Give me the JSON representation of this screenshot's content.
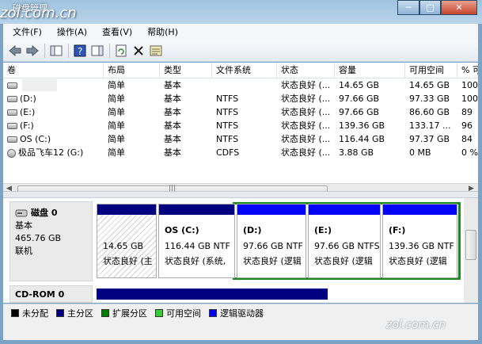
{
  "window": {
    "title": "磁盘管理",
    "watermark": "zol.com.cn",
    "min": "─",
    "max": "□",
    "close": "✕"
  },
  "menu": [
    "文件(F)",
    "操作(A)",
    "查看(V)",
    "帮助(H)"
  ],
  "toolbar": {
    "icons": [
      "back-arrow-icon",
      "forward-arrow-icon",
      "console-tree-icon",
      "help-icon",
      "show-action-pane-icon",
      "refresh-icon",
      "delete-icon",
      "properties-icon"
    ]
  },
  "table": {
    "columns": [
      "卷",
      "布局",
      "类型",
      "文件系统",
      "状态",
      "容量",
      "可用空间",
      "% 可"
    ],
    "rows": [
      [
        "",
        "简单",
        "基本",
        "",
        "状态良好 (...",
        "14.65 GB",
        "14.65 GB",
        "100"
      ],
      [
        "(D:)",
        "简单",
        "基本",
        "NTFS",
        "状态良好 (...",
        "97.66 GB",
        "97.33 GB",
        "100"
      ],
      [
        "(E:)",
        "简单",
        "基本",
        "NTFS",
        "状态良好 (...",
        "97.66 GB",
        "86.60 GB",
        "89"
      ],
      [
        "(F:)",
        "简单",
        "基本",
        "NTFS",
        "状态良好 (...",
        "139.36 GB",
        "133.17 ...",
        "96"
      ],
      [
        "OS (C:)",
        "简单",
        "基本",
        "NTFS",
        "状态良好 (...",
        "116.44 GB",
        "97.37 GB",
        "84"
      ],
      [
        "极品飞车12 (G:)",
        "简单",
        "基本",
        "CDFS",
        "状态良好 (...",
        "3.88 GB",
        "0 MB",
        "0 %"
      ]
    ],
    "scroll_arrows": [
      "◀",
      "▶",
      "|||"
    ]
  },
  "disk0": {
    "name": "磁盘 0",
    "type": "基本",
    "size": "465.76 GB",
    "status": "联机"
  },
  "partitions": [
    {
      "name": "",
      "size": "14.65 GB",
      "status": "状态良好 (主",
      "color": "#000080",
      "hatched": true
    },
    {
      "name": "OS  (C:)",
      "size": "116.44 GB NTF",
      "status": "状态良好 (系统,",
      "color": "#000080",
      "hatched": false
    },
    {
      "name": "(D:)",
      "size": "97.66 GB NTF",
      "status": "状态良好 (逻辑",
      "color": "#0000ff",
      "hatched": false
    },
    {
      "name": "(E:)",
      "size": "97.66 GB NTFS",
      "status": "状态良好 (逻辑",
      "color": "#0000ff",
      "hatched": false
    },
    {
      "name": "(F:)",
      "size": "139.36 GB NTF",
      "status": "状态良好 (逻辑",
      "color": "#0000ff",
      "hatched": false
    }
  ],
  "cdrom": {
    "name": "CD-ROM 0"
  },
  "legend": [
    {
      "label": "未分配",
      "color": "#000000"
    },
    {
      "label": "主分区",
      "color": "#000080"
    },
    {
      "label": "扩展分区",
      "color": "#008000"
    },
    {
      "label": "可用空间",
      "color": "#33cc33"
    },
    {
      "label": "逻辑驱动器",
      "color": "#0000ff"
    }
  ],
  "watermark_bottom": "zol.com.cn"
}
